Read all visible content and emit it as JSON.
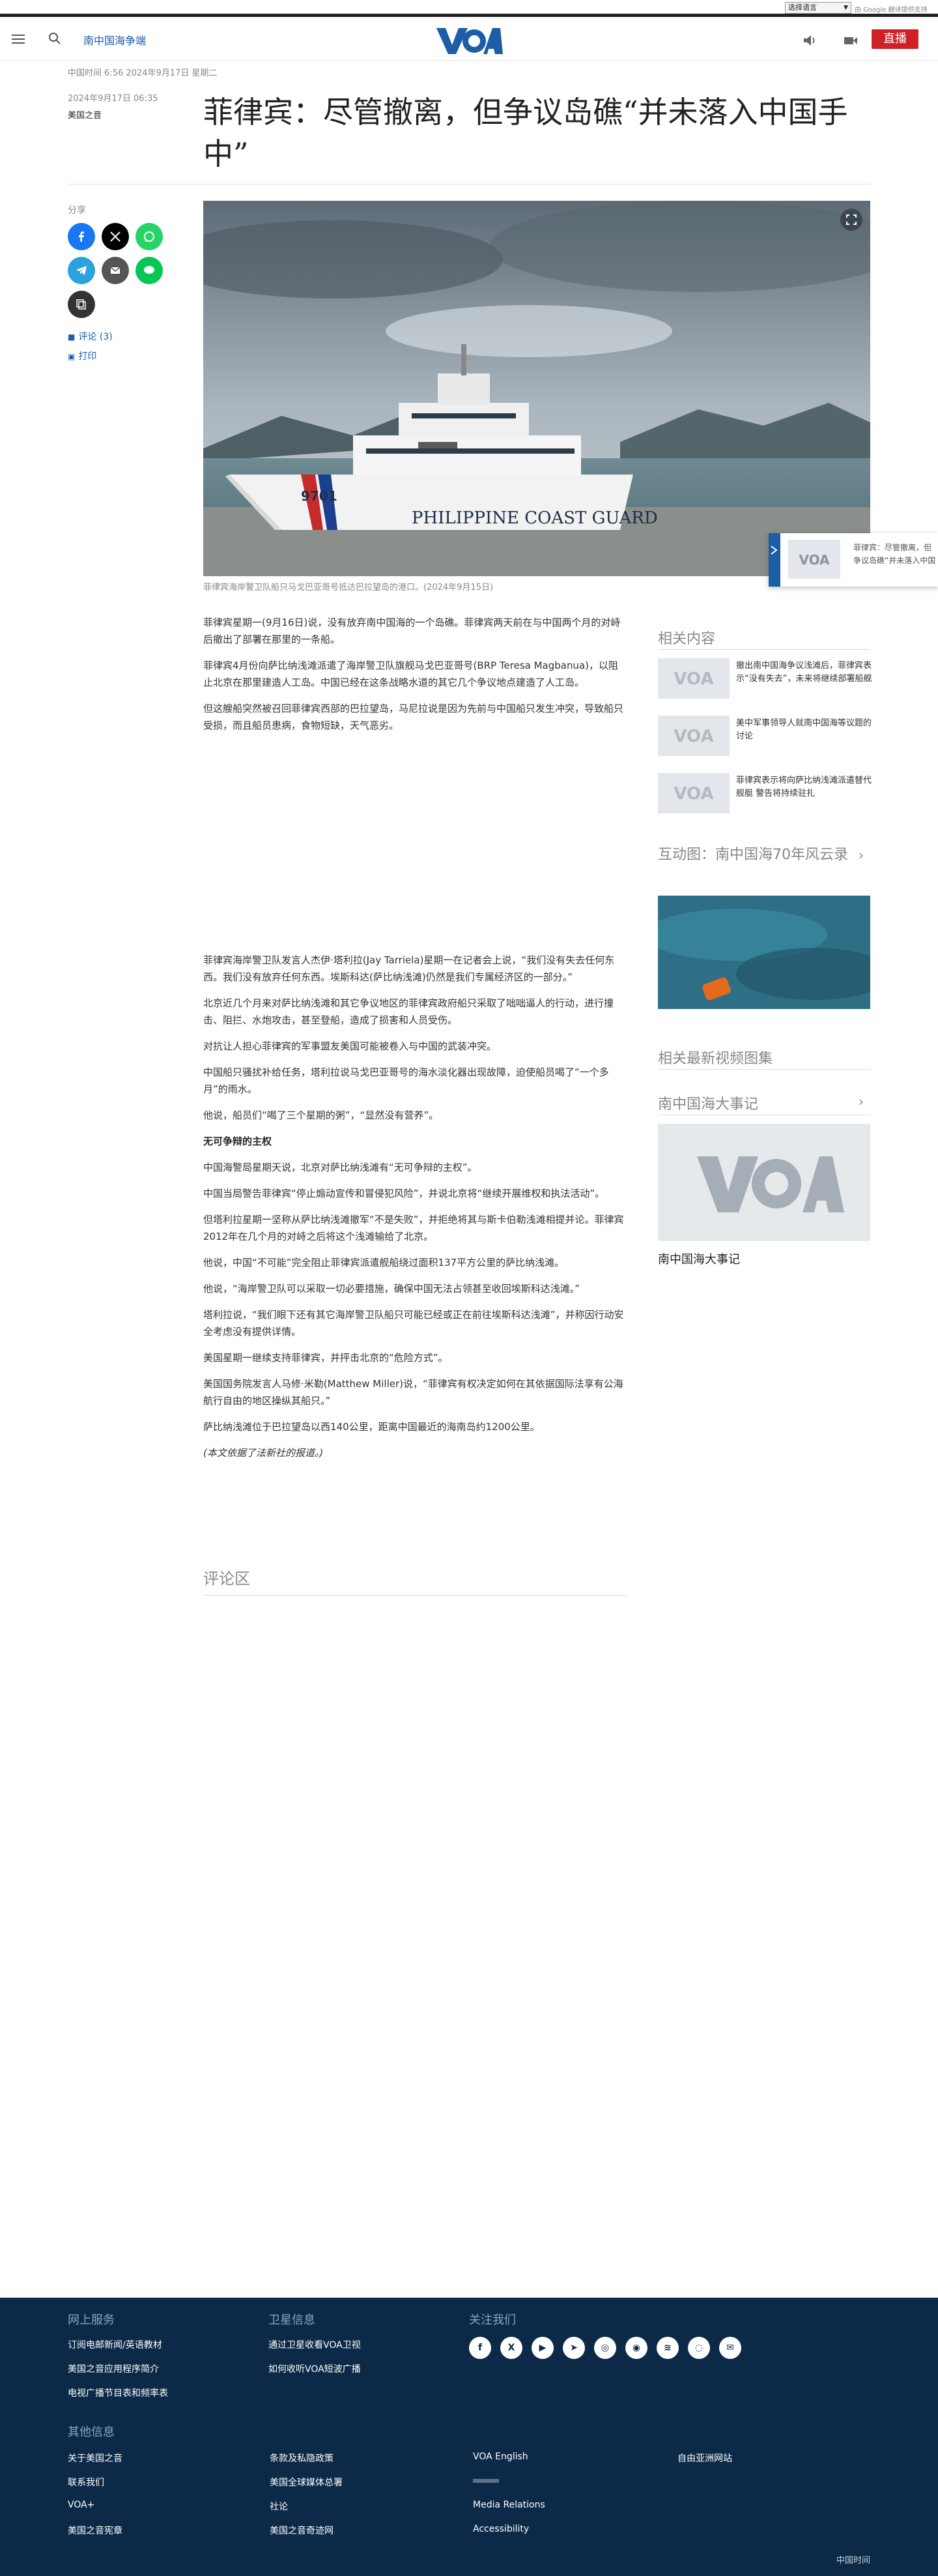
{
  "translate_bar": {
    "select_label": "选择语言",
    "powered_by": "由 Google 翻译提供支持"
  },
  "header": {
    "section": "南中国海争端",
    "live_label": "直播"
  },
  "meta": {
    "updated": "中国时间 6:56 2024年9月17日 星期二",
    "date": "2024年9月17日 06:35",
    "source": "美国之音"
  },
  "article": {
    "title": "菲律宾：尽管撤离，但争议岛礁“并未落入中国手中”",
    "share_label": "分享",
    "comments_link": "评论 (3)",
    "print_link": "打印",
    "hero_ship_text": "PHILIPPINE COAST GUARD",
    "hero_hull_number": "9701",
    "caption": "菲律宾海岸警卫队船只马戈巴亚哥号抵达巴拉望岛的港口。(2024年9月15日)",
    "paragraphs_top": [
      "菲律宾星期一(9月16日)说，没有放弃南中国海的一个岛礁。菲律宾两天前在与中国两个月的对峙后撤出了部署在那里的一条船。",
      "菲律宾4月份向萨比纳浅滩派遣了海岸警卫队旗舰马戈巴亚哥号(BRP Teresa Magbanua)，以阻止北京在那里建造人工岛。中国已经在这条战略水道的其它几个争议地点建造了人工岛。",
      "但这艘船突然被召回菲律宾西部的巴拉望岛，马尼拉说是因为先前与中国船只发生冲突，导致船只受损，而且船员患病，食物短缺，天气恶劣。"
    ],
    "paragraphs_bottom": [
      "菲律宾海岸警卫队发言人杰伊·塔利拉(Jay Tarriela)星期一在记者会上说，“我们没有失去任何东西。我们没有放弃任何东西。埃斯科达(萨比纳浅滩)仍然是我们专属经济区的一部分。”",
      "北京近几个月来对萨比纳浅滩和其它争议地区的菲律宾政府船只采取了咄咄逼人的行动，进行撞击、阻拦、水炮攻击，甚至登船，造成了损害和人员受伤。",
      "对抗让人担心菲律宾的军事盟友美国可能被卷入与中国的武装冲突。",
      "中国船只骚扰补给任务，塔利拉说马戈巴亚哥号的海水淡化器出现故障，迫使船员喝了“一个多月”的雨水。",
      "他说，船员们“喝了三个星期的粥”，“显然没有营养”。"
    ],
    "subhead": "无可争辩的主权",
    "paragraphs_final": [
      "中国海警局星期天说，北京对萨比纳浅滩有“无可争辩的主权”。",
      "中国当局警告菲律宾“停止煽动宣传和冒侵犯风险”，并说北京将“继续开展维权和执法活动”。",
      "但塔利拉星期一坚称从萨比纳浅滩撤军“不是失败”，并拒绝将其与斯卡伯勒浅滩相提并论。菲律宾2012年在几个月的对峙之后将这个浅滩输给了北京。",
      "他说，中国“不可能”完全阻止菲律宾派遣舰船绕过面积137平方公里的萨比纳浅滩。",
      "他说，“海岸警卫队可以采取一切必要措施，确保中国无法占领甚至收回埃斯科达浅滩。”",
      "塔利拉说，“我们眼下还有其它海岸警卫队船只可能已经或正在前往埃斯科达浅滩”，并称因行动安全考虑没有提供详情。",
      "美国星期一继续支持菲律宾，并抨击北京的“危险方式”。",
      "美国国务院发言人马修·米勒(Matthew Miller)说，“菲律宾有权决定如何在其依据国际法享有公海航行自由的地区操纵其船只。”",
      "萨比纳浅滩位于巴拉望岛以西140公里，距离中国最近的海南岛约1200公里。"
    ],
    "source_note": "(本文依据了法新社的报道。)",
    "comments_heading": "评论区"
  },
  "sidebar": {
    "related_heading": "相关内容",
    "related": [
      "撤出南中国海争议浅滩后，菲律宾表示“没有失去”，未来将继续部署船舰",
      "美中军事领导人就南中国海等议题的讨论",
      "菲律宾表示将向萨比纳浅滩派遣替代舰艇 警告将持续驻扎"
    ],
    "interactive_heading": "互动图：南中国海70年风云录",
    "video_heading": "相关最新视频图集",
    "timeline_heading": "南中国海大事记",
    "timeline_caption": "南中国海大事记"
  },
  "popup": {
    "text": "菲律宾：尽管撤离，但争议岛礁“并未落入中国手中”"
  },
  "footer": {
    "col1_heading": "网上服务",
    "col1": [
      "订阅电邮新闻/英语教材",
      "美国之音应用程序简介",
      "电视广播节目表和频率表"
    ],
    "col2_heading": "卫星信息",
    "col2": [
      "通过卫星收看VOA卫视",
      "如何收听VOA短波广播"
    ],
    "col3_heading": "关注我们",
    "social_icons": [
      "facebook-icon",
      "x-icon",
      "youtube-icon",
      "telegram-icon",
      "instagram-icon",
      "podcast-icon",
      "rss-icon",
      "signal-icon",
      "email-icon"
    ],
    "other_heading": "其他信息",
    "other_col1": [
      "关于美国之音",
      "联系我们",
      "VOA+",
      "美国之音宪章"
    ],
    "other_col2": [
      "条款及私隐政策",
      "美国全球媒体总署",
      "社论",
      "美国之音奇迹网"
    ],
    "other_col3": [
      "VOA English",
      "",
      "Media Relations",
      "Accessibility"
    ],
    "other_col4": [
      "自由亚洲网站"
    ],
    "time_label": "中国时间"
  },
  "colors": {
    "brand_blue": "#1b5ea6",
    "live_red": "#d01f27",
    "footer_bg": "#0c2a48"
  }
}
